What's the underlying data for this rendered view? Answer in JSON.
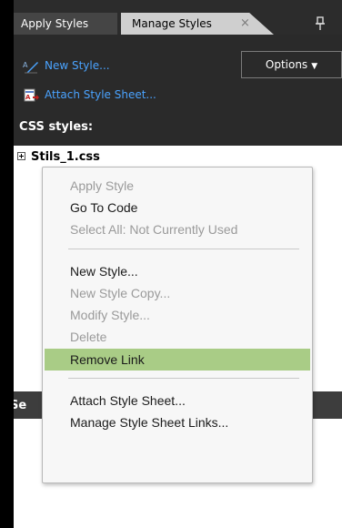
{
  "tabs": [
    {
      "label": "Apply Styles"
    },
    {
      "label": "Manage Styles",
      "close": "×"
    }
  ],
  "pin_glyph": "📌",
  "toolbar": {
    "new_style": "New Style...",
    "attach_style_sheet": "Attach Style Sheet...",
    "options": "Options"
  },
  "css_styles_label": "CSS styles:",
  "stylesheet": "Stils_1.css",
  "lower_section_label": "Se",
  "context_menu": {
    "items": [
      {
        "label": "Apply Style",
        "enabled": false
      },
      {
        "label": "Go To Code",
        "enabled": true
      },
      {
        "label": "Select All: Not Currently Used",
        "enabled": false
      },
      {
        "label": "New Style...",
        "enabled": true
      },
      {
        "label": "New Style Copy...",
        "enabled": false
      },
      {
        "label": "Modify Style...",
        "enabled": false
      },
      {
        "label": "Delete",
        "enabled": false
      },
      {
        "label": "Remove Link",
        "enabled": true,
        "highlighted": true
      },
      {
        "label": "Attach Style Sheet...",
        "enabled": true
      },
      {
        "label": "Manage Style Sheet Links...",
        "enabled": true
      }
    ]
  },
  "colors": {
    "link": "#4aa3ff",
    "highlight": "#a9cc86",
    "panel_bg": "#2a2a2a"
  }
}
